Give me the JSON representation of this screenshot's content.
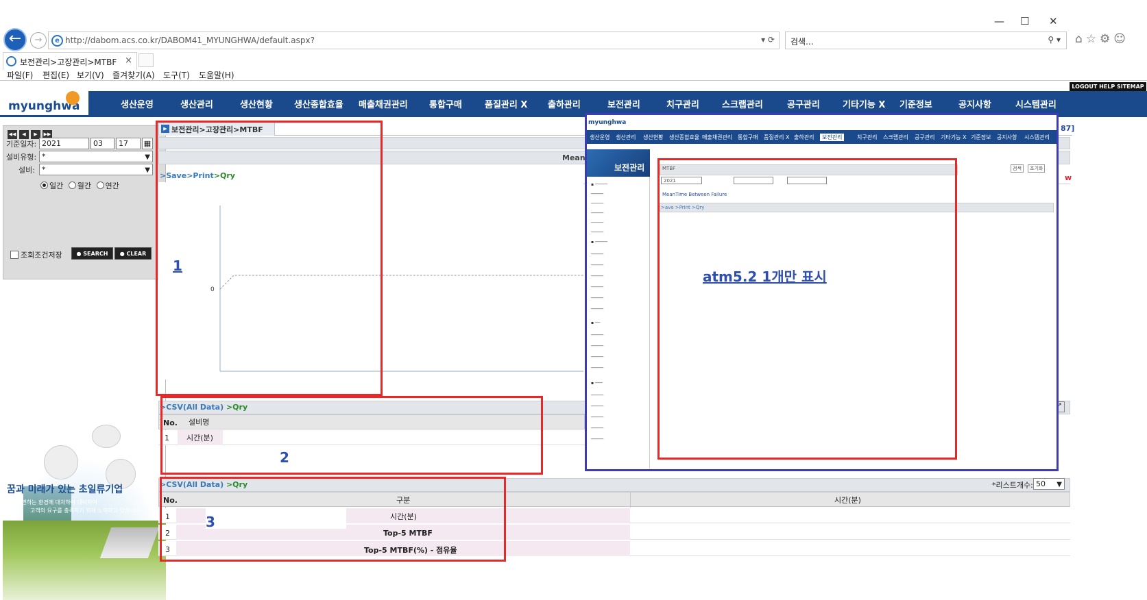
{
  "browser": {
    "url": "http://dabom.acs.co.kr/DABOM41_MYUNGHWA/default.aspx?",
    "search_placeholder": "검색...",
    "tab_title": "보전관리>고장관리>MTBF",
    "tab_close": "×",
    "menu": [
      "파일(F)",
      "편집(E)",
      "보기(V)",
      "즐겨찾기(A)",
      "도구(T)",
      "도움말(H)"
    ],
    "window_controls": [
      "—",
      "☐",
      "✕"
    ]
  },
  "app": {
    "logo": "myunghwa",
    "top_links": "LOGOUT HELP SITEMAP",
    "nav": [
      "생산운영",
      "생산관리",
      "생산현황",
      "생산종합효율",
      "매출채권관리",
      "통합구매",
      "품질관리 X",
      "출하관리",
      "보전관리",
      "치구관리",
      "스크랩관리",
      "공구관리",
      "기타기능 X",
      "기준정보",
      "공지사항",
      "시스템관리"
    ]
  },
  "search_panel": {
    "date_label": "기준일자:",
    "year": "2021",
    "month": "03",
    "day": "17",
    "equip_type_label": "설비유형:",
    "equip_type_value": "*",
    "equip_label": "설비:",
    "equip_value": "*",
    "period_options": [
      "일간",
      "월간",
      "연간"
    ],
    "period_selected": "일간",
    "save_condition": "조회조건저장",
    "search_btn": "SEARCH",
    "clear_btn": "CLEAR"
  },
  "promo": {
    "headline": "꿈과 미래가 있는 초일류기업",
    "sub1": "급변하는 환경에 대처하여 대비하여",
    "sub2": "고객의 요구를 충족하기 위해 노력하고 있습니다."
  },
  "main": {
    "breadcrumb": "보전관리>고장관리>MTBF",
    "mean_label": "MeanT",
    "chart_links": {
      "save": ">Save",
      "print": ">Print",
      "qry": ">Qry"
    },
    "chart_zero": "0",
    "grid1": {
      "links": {
        "csv": ">CSV(All Data)",
        "qry": ">Qry"
      },
      "col_no": "No.",
      "col_equip": "설비명",
      "row_no": "1",
      "row_label": "시간(분)"
    },
    "grid2": {
      "links": {
        "csv": ">CSV(All Data)",
        "qry": ">Qry"
      },
      "list_count_label": "*리스트개수:",
      "list_count": "50",
      "col_no": "No.",
      "col_type": "구분",
      "col_time": "시간(분)",
      "rows": [
        {
          "no": "1",
          "label": "시간(분)"
        },
        {
          "no": "2",
          "label": "Top-5 MTBF"
        },
        {
          "no": "3",
          "label": "Top-5 MTBF(%) - 점유율"
        }
      ]
    },
    "right_edge": {
      "num": "87]",
      "www": "w"
    }
  },
  "annotations": {
    "a1": "1",
    "a2": "2",
    "a3": "3",
    "note": "atm5.2  1개만 표시"
  },
  "inset": {
    "logo": "myunghwa",
    "nav": [
      "생산운영",
      "생산관리",
      "생산현황",
      "생산종합효율",
      "매출채권관리",
      "통합구매",
      "품질관리 X",
      "출하관리",
      "보전관리",
      "치구관리",
      "스크랩관리",
      "공구관리",
      "기타기능 X",
      "기준정보",
      "공지사항",
      "시스템관리"
    ],
    "section": "보전관리",
    "crumb": "MTBF",
    "title": "MeanTime Between Failure",
    "links": ">ave >Print >Qry",
    "year": "2021",
    "search": "검색",
    "reset": "초기화"
  }
}
